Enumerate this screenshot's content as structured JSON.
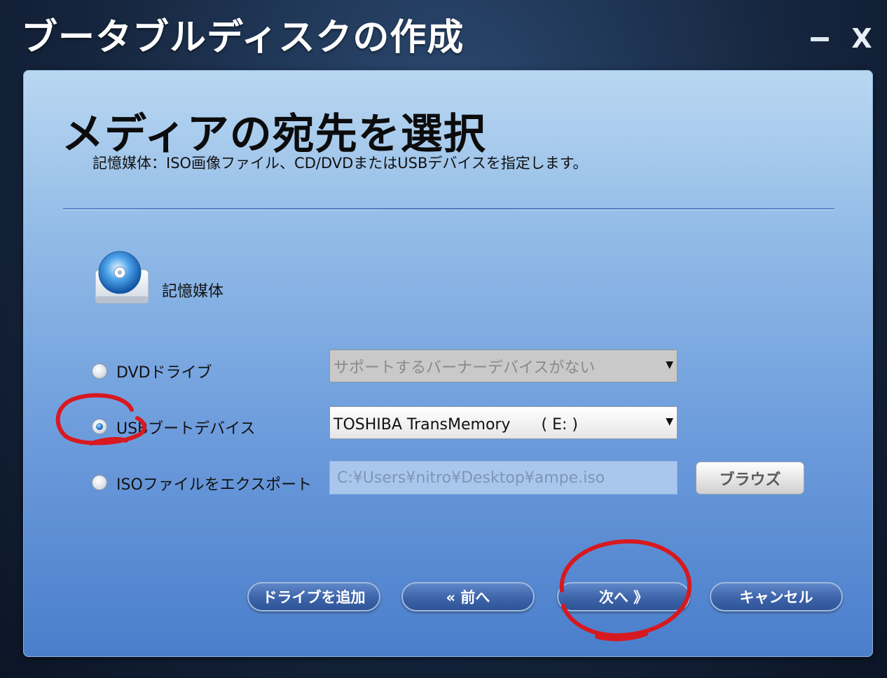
{
  "window": {
    "title": "ブータブルディスクの作成",
    "minimize_symbol": "",
    "close_symbol": "X"
  },
  "page": {
    "heading": "メディアの宛先を選択",
    "subtitle": "記憶媒体：ISO画像ファイル、CD/DVDまたはUSBデバイスを指定します。"
  },
  "storage": {
    "label": "記憶媒体",
    "icon": "disc-drive-icon"
  },
  "options": {
    "dvd": {
      "label": "DVDドライブ",
      "checked": false,
      "select_value": "サポートするバーナーデバイスがない",
      "select_enabled": false
    },
    "usb": {
      "label": "USBブートデバイス",
      "checked": true,
      "select_value": "TOSHIBA TransMemory　　( E: )",
      "select_enabled": true
    },
    "iso": {
      "label": "ISOファイルをエクスポート",
      "checked": false,
      "path_value": "C:¥Users¥nitro¥Desktop¥ampe.iso",
      "browse_label": "ブラウズ"
    }
  },
  "buttons": {
    "add_drive": "ドライブを追加",
    "back": "« 前へ",
    "next": "次へ 》",
    "cancel": "キャンセル"
  },
  "colors": {
    "annotation_red": "#d71920",
    "panel_top": "#b9d7f1",
    "panel_bottom": "#4a7ecb",
    "button_blue": "#3d63a8"
  }
}
